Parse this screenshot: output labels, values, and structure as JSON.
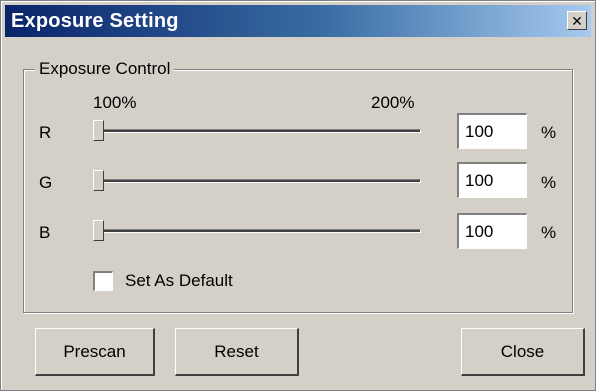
{
  "window": {
    "title": "Exposure Setting",
    "close_glyph": "✕"
  },
  "exposure_control": {
    "group_label": "Exposure Control",
    "scale_min_label": "100%",
    "scale_max_label": "200%",
    "sliders": [
      {
        "label": "R",
        "value": "100",
        "unit": "%",
        "slider_fraction": 0
      },
      {
        "label": "G",
        "value": "100",
        "unit": "%",
        "slider_fraction": 0
      },
      {
        "label": "B",
        "value": "100",
        "unit": "%",
        "slider_fraction": 0
      }
    ],
    "set_as_default": {
      "label": "Set As Default",
      "checked": false
    }
  },
  "buttons": {
    "prescan": "Prescan",
    "reset": "Reset",
    "close": "Close"
  }
}
